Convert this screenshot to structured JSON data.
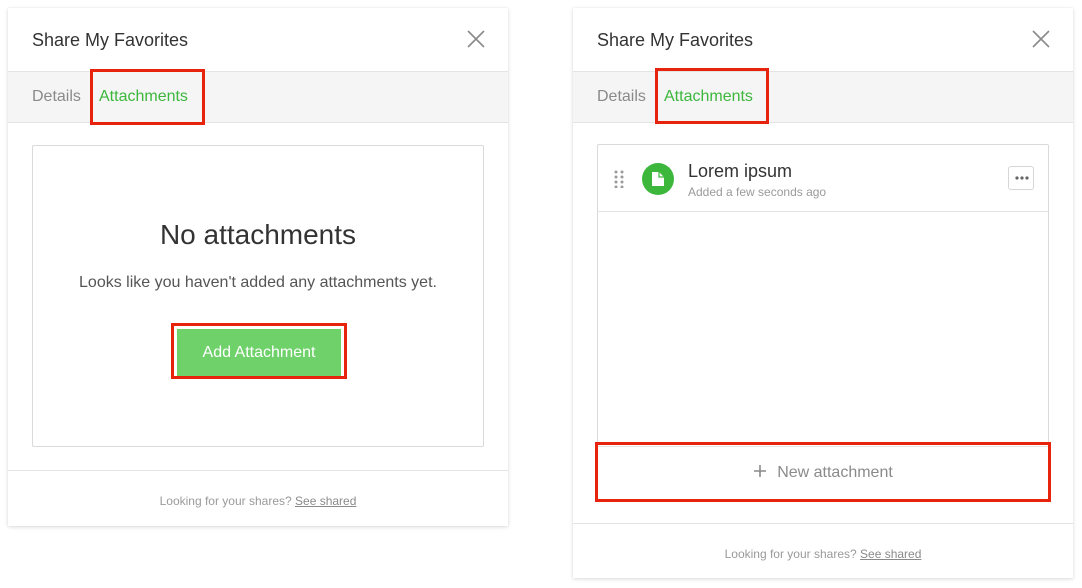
{
  "colors": {
    "accent_green": "#3cb73c",
    "button_green": "#6fd16a",
    "highlight_red": "#e8230c"
  },
  "panel_left": {
    "title": "Share My Favorites",
    "tabs": [
      {
        "label": "Details",
        "active": false
      },
      {
        "label": "Attachments",
        "active": true
      }
    ],
    "empty_state": {
      "heading": "No attachments",
      "message": "Looks like you haven't added any attachments yet.",
      "button_label": "Add Attachment"
    },
    "footer": {
      "text": "Looking for your shares?",
      "link": "See shared"
    }
  },
  "panel_right": {
    "title": "Share My Favorites",
    "tabs": [
      {
        "label": "Details",
        "active": false
      },
      {
        "label": "Attachments",
        "active": true
      }
    ],
    "attachments": [
      {
        "title": "Lorem ipsum",
        "meta": "Added a few seconds ago",
        "icon": "file-icon"
      }
    ],
    "new_attachment_label": "New attachment",
    "footer": {
      "text": "Looking for your shares?",
      "link": "See shared"
    }
  },
  "icons": [
    "close-icon",
    "file-icon",
    "drag-handle-icon",
    "more-icon",
    "plus-icon"
  ]
}
